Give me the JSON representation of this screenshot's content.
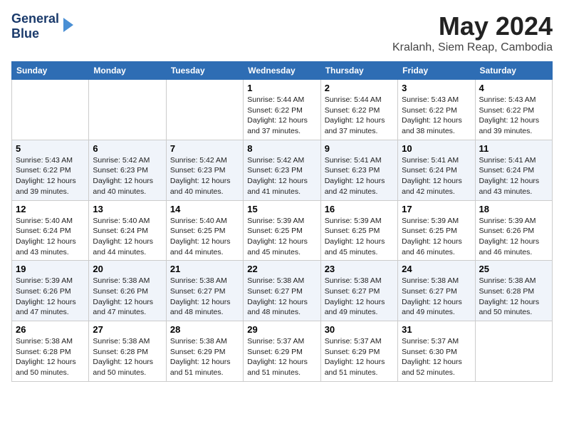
{
  "logo": {
    "line1": "General",
    "line2": "Blue"
  },
  "title": "May 2024",
  "location": "Kralanh, Siem Reap, Cambodia",
  "weekdays": [
    "Sunday",
    "Monday",
    "Tuesday",
    "Wednesday",
    "Thursday",
    "Friday",
    "Saturday"
  ],
  "weeks": [
    [
      {
        "day": "",
        "info": ""
      },
      {
        "day": "",
        "info": ""
      },
      {
        "day": "",
        "info": ""
      },
      {
        "day": "1",
        "info": "Sunrise: 5:44 AM\nSunset: 6:22 PM\nDaylight: 12 hours\nand 37 minutes."
      },
      {
        "day": "2",
        "info": "Sunrise: 5:44 AM\nSunset: 6:22 PM\nDaylight: 12 hours\nand 37 minutes."
      },
      {
        "day": "3",
        "info": "Sunrise: 5:43 AM\nSunset: 6:22 PM\nDaylight: 12 hours\nand 38 minutes."
      },
      {
        "day": "4",
        "info": "Sunrise: 5:43 AM\nSunset: 6:22 PM\nDaylight: 12 hours\nand 39 minutes."
      }
    ],
    [
      {
        "day": "5",
        "info": "Sunrise: 5:43 AM\nSunset: 6:22 PM\nDaylight: 12 hours\nand 39 minutes."
      },
      {
        "day": "6",
        "info": "Sunrise: 5:42 AM\nSunset: 6:23 PM\nDaylight: 12 hours\nand 40 minutes."
      },
      {
        "day": "7",
        "info": "Sunrise: 5:42 AM\nSunset: 6:23 PM\nDaylight: 12 hours\nand 40 minutes."
      },
      {
        "day": "8",
        "info": "Sunrise: 5:42 AM\nSunset: 6:23 PM\nDaylight: 12 hours\nand 41 minutes."
      },
      {
        "day": "9",
        "info": "Sunrise: 5:41 AM\nSunset: 6:23 PM\nDaylight: 12 hours\nand 42 minutes."
      },
      {
        "day": "10",
        "info": "Sunrise: 5:41 AM\nSunset: 6:24 PM\nDaylight: 12 hours\nand 42 minutes."
      },
      {
        "day": "11",
        "info": "Sunrise: 5:41 AM\nSunset: 6:24 PM\nDaylight: 12 hours\nand 43 minutes."
      }
    ],
    [
      {
        "day": "12",
        "info": "Sunrise: 5:40 AM\nSunset: 6:24 PM\nDaylight: 12 hours\nand 43 minutes."
      },
      {
        "day": "13",
        "info": "Sunrise: 5:40 AM\nSunset: 6:24 PM\nDaylight: 12 hours\nand 44 minutes."
      },
      {
        "day": "14",
        "info": "Sunrise: 5:40 AM\nSunset: 6:25 PM\nDaylight: 12 hours\nand 44 minutes."
      },
      {
        "day": "15",
        "info": "Sunrise: 5:39 AM\nSunset: 6:25 PM\nDaylight: 12 hours\nand 45 minutes."
      },
      {
        "day": "16",
        "info": "Sunrise: 5:39 AM\nSunset: 6:25 PM\nDaylight: 12 hours\nand 45 minutes."
      },
      {
        "day": "17",
        "info": "Sunrise: 5:39 AM\nSunset: 6:25 PM\nDaylight: 12 hours\nand 46 minutes."
      },
      {
        "day": "18",
        "info": "Sunrise: 5:39 AM\nSunset: 6:26 PM\nDaylight: 12 hours\nand 46 minutes."
      }
    ],
    [
      {
        "day": "19",
        "info": "Sunrise: 5:39 AM\nSunset: 6:26 PM\nDaylight: 12 hours\nand 47 minutes."
      },
      {
        "day": "20",
        "info": "Sunrise: 5:38 AM\nSunset: 6:26 PM\nDaylight: 12 hours\nand 47 minutes."
      },
      {
        "day": "21",
        "info": "Sunrise: 5:38 AM\nSunset: 6:27 PM\nDaylight: 12 hours\nand 48 minutes."
      },
      {
        "day": "22",
        "info": "Sunrise: 5:38 AM\nSunset: 6:27 PM\nDaylight: 12 hours\nand 48 minutes."
      },
      {
        "day": "23",
        "info": "Sunrise: 5:38 AM\nSunset: 6:27 PM\nDaylight: 12 hours\nand 49 minutes."
      },
      {
        "day": "24",
        "info": "Sunrise: 5:38 AM\nSunset: 6:27 PM\nDaylight: 12 hours\nand 49 minutes."
      },
      {
        "day": "25",
        "info": "Sunrise: 5:38 AM\nSunset: 6:28 PM\nDaylight: 12 hours\nand 50 minutes."
      }
    ],
    [
      {
        "day": "26",
        "info": "Sunrise: 5:38 AM\nSunset: 6:28 PM\nDaylight: 12 hours\nand 50 minutes."
      },
      {
        "day": "27",
        "info": "Sunrise: 5:38 AM\nSunset: 6:28 PM\nDaylight: 12 hours\nand 50 minutes."
      },
      {
        "day": "28",
        "info": "Sunrise: 5:38 AM\nSunset: 6:29 PM\nDaylight: 12 hours\nand 51 minutes."
      },
      {
        "day": "29",
        "info": "Sunrise: 5:37 AM\nSunset: 6:29 PM\nDaylight: 12 hours\nand 51 minutes."
      },
      {
        "day": "30",
        "info": "Sunrise: 5:37 AM\nSunset: 6:29 PM\nDaylight: 12 hours\nand 51 minutes."
      },
      {
        "day": "31",
        "info": "Sunrise: 5:37 AM\nSunset: 6:30 PM\nDaylight: 12 hours\nand 52 minutes."
      },
      {
        "day": "",
        "info": ""
      }
    ]
  ]
}
